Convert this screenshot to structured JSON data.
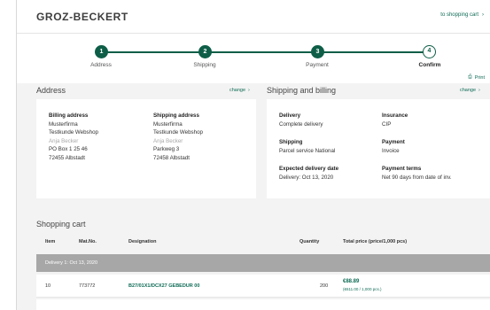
{
  "header": {
    "logo": "GROZ-BECKERT",
    "to_cart": "to shopping cart"
  },
  "steps": [
    {
      "number": "1",
      "label": "Address",
      "state": "done"
    },
    {
      "number": "2",
      "label": "Shipping",
      "state": "done"
    },
    {
      "number": "3",
      "label": "Payment",
      "state": "done"
    },
    {
      "number": "4",
      "label": "Confirm",
      "state": "current"
    }
  ],
  "print_label": "Print",
  "address": {
    "title": "Address",
    "change": "change",
    "billing": {
      "heading": "Billing address",
      "lines": [
        "Musterfirma",
        "Testkunde Webshop",
        "Anja Becker",
        "PO Box 1 25 46",
        "72455 Albstadt"
      ]
    },
    "shipping": {
      "heading": "Shipping address",
      "lines": [
        "Musterfirma",
        "Testkunde Webshop",
        "Anja Becker",
        "Parkweg 3",
        "72458 Albstadt"
      ]
    }
  },
  "shipping_billing": {
    "title": "Shipping and billing",
    "change": "change",
    "delivery": {
      "heading": "Delivery",
      "value": "Complete delivery"
    },
    "insurance": {
      "heading": "Insurance",
      "value": "CIP"
    },
    "shipping": {
      "heading": "Shipping",
      "value": "Parcel service National"
    },
    "payment": {
      "heading": "Payment",
      "value": "Invoice"
    },
    "expected": {
      "heading": "Expected delivery date",
      "value": "Delivery: Oct 13, 2020"
    },
    "terms": {
      "heading": "Payment terms",
      "value": "Net 90 days from date of inv."
    }
  },
  "cart": {
    "title": "Shopping cart",
    "columns": [
      "Item",
      "Mat.No.",
      "Designation",
      "Quantity",
      "Total price (price/1,000 pcs)"
    ],
    "delivery_group": "Delivery 1: Oct 13, 2020",
    "rows": [
      {
        "item": "10",
        "mat_no": "773772",
        "designation": "B27/01X1/DCX27 GEBEDUR 00",
        "quantity": "200",
        "price": "€88.89",
        "price_per": "(€611.00 / 1,000 pcs.)"
      }
    ]
  },
  "colors": {
    "accent": "#0e5e47",
    "link": "#0e6b55",
    "group_bar": "#a7a7a7"
  }
}
